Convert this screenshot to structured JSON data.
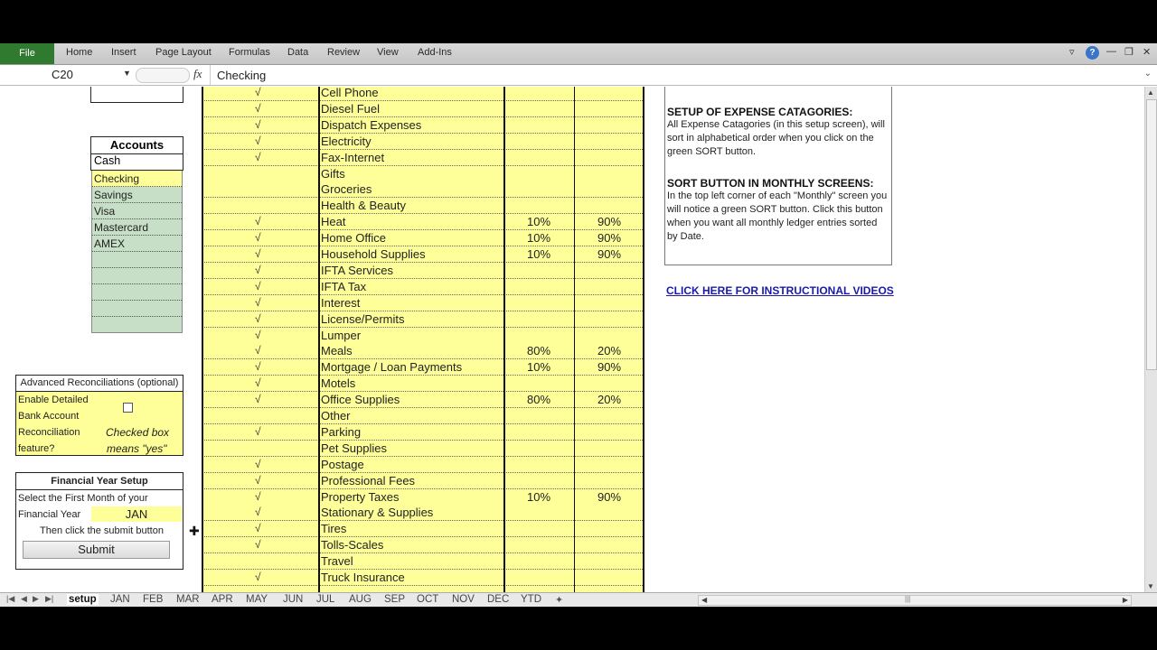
{
  "ribbon": {
    "file": "File",
    "tabs": [
      "Home",
      "Insert",
      "Page Layout",
      "Formulas",
      "Data",
      "Review",
      "View",
      "Add-Ins"
    ],
    "window_controls": {
      "ribbon_toggle": "▿",
      "help": "?",
      "minimize": "—",
      "restore": "❐",
      "close": "✕"
    }
  },
  "formula_bar": {
    "name_box": "C20",
    "fx_label": "fx",
    "value": "Checking",
    "expand_icon": "⌄"
  },
  "accounts": {
    "title": "Accounts",
    "items": [
      "Cash",
      "Checking",
      "Savings",
      "Visa",
      "Mastercard",
      "AMEX",
      "",
      "",
      "",
      ""
    ],
    "selected": "Checking"
  },
  "reconciliation": {
    "title": "Advanced Reconciliations (optional)",
    "lines": [
      "Enable Detailed",
      "Bank Account",
      "Reconciliation",
      "feature?"
    ],
    "note_line1": "Checked box",
    "note_line2": "means \"yes\"",
    "checked": false
  },
  "financial_year": {
    "title": "Financial Year Setup",
    "line1": "Select the First Month of your",
    "label": "Financial Year",
    "month": "JAN",
    "instruction": "Then click the submit button",
    "submit": "Submit"
  },
  "expenses": [
    {
      "check": "√",
      "name": "Cell Phone",
      "p1": "",
      "p2": ""
    },
    {
      "check": "√",
      "name": "Diesel Fuel",
      "p1": "",
      "p2": ""
    },
    {
      "check": "√",
      "name": "Dispatch Expenses",
      "p1": "",
      "p2": ""
    },
    {
      "check": "√",
      "name": "Electricity",
      "p1": "",
      "p2": ""
    },
    {
      "check": "√",
      "name": "Fax-Internet",
      "p1": "",
      "p2": ""
    },
    {
      "check": "",
      "name": "Gifts",
      "p1": "",
      "p2": ""
    },
    {
      "check": "",
      "name": "Groceries",
      "p1": "",
      "p2": ""
    },
    {
      "check": "",
      "name": "Health & Beauty",
      "p1": "",
      "p2": ""
    },
    {
      "check": "√",
      "name": "Heat",
      "p1": "10%",
      "p2": "90%"
    },
    {
      "check": "√",
      "name": "Home Office",
      "p1": "10%",
      "p2": "90%"
    },
    {
      "check": "√",
      "name": "Household Supplies",
      "p1": "10%",
      "p2": "90%"
    },
    {
      "check": "√",
      "name": "IFTA Services",
      "p1": "",
      "p2": ""
    },
    {
      "check": "√",
      "name": "IFTA Tax",
      "p1": "",
      "p2": ""
    },
    {
      "check": "√",
      "name": "Interest",
      "p1": "",
      "p2": ""
    },
    {
      "check": "√",
      "name": "License/Permits",
      "p1": "",
      "p2": ""
    },
    {
      "check": "√",
      "name": "Lumper",
      "p1": "",
      "p2": ""
    },
    {
      "check": "√",
      "name": "Meals",
      "p1": "80%",
      "p2": "20%"
    },
    {
      "check": "√",
      "name": "Mortgage / Loan Payments",
      "p1": "10%",
      "p2": "90%"
    },
    {
      "check": "√",
      "name": "Motels",
      "p1": "",
      "p2": ""
    },
    {
      "check": "√",
      "name": "Office Supplies",
      "p1": "80%",
      "p2": "20%"
    },
    {
      "check": "",
      "name": "Other",
      "p1": "",
      "p2": ""
    },
    {
      "check": "√",
      "name": "Parking",
      "p1": "",
      "p2": ""
    },
    {
      "check": "",
      "name": "Pet Supplies",
      "p1": "",
      "p2": ""
    },
    {
      "check": "√",
      "name": "Postage",
      "p1": "",
      "p2": ""
    },
    {
      "check": "√",
      "name": "Professional Fees",
      "p1": "",
      "p2": ""
    },
    {
      "check": "√",
      "name": "Property Taxes",
      "p1": "10%",
      "p2": "90%"
    },
    {
      "check": "√",
      "name": "Stationary & Supplies",
      "p1": "",
      "p2": ""
    },
    {
      "check": "√",
      "name": "Tires",
      "p1": "",
      "p2": ""
    },
    {
      "check": "√",
      "name": "Tolls-Scales",
      "p1": "",
      "p2": ""
    },
    {
      "check": "",
      "name": "Travel",
      "p1": "",
      "p2": ""
    },
    {
      "check": "√",
      "name": "Truck Insurance",
      "p1": "",
      "p2": ""
    }
  ],
  "info": {
    "heading1": "SETUP OF EXPENSE CATAGORIES:",
    "body1": "All Expense Catagories (in this setup screen), will sort in alphabetical order when you click on the green SORT button.",
    "heading2": "SORT BUTTON IN MONTHLY SCREENS:",
    "body2": "In the top left corner of each \"Monthly\" screen you will notice a green SORT button. Click this button when you want all monthly ledger entries sorted by Date.",
    "link": "CLICK HERE FOR  INSTRUCTIONAL VIDEOS"
  },
  "sheet_tabs": {
    "active": "setup",
    "tabs": [
      "setup",
      "JAN",
      "FEB",
      "MAR",
      "APR",
      "MAY",
      "JUN",
      "JUL",
      "AUG",
      "SEP",
      "OCT",
      "NOV",
      "DEC",
      "YTD"
    ]
  },
  "colors": {
    "file_tab": "#2f7a2f",
    "cell_yellow": "#ffff99",
    "account_green": "#c6dfc6",
    "link_blue": "#1a1aa6"
  }
}
